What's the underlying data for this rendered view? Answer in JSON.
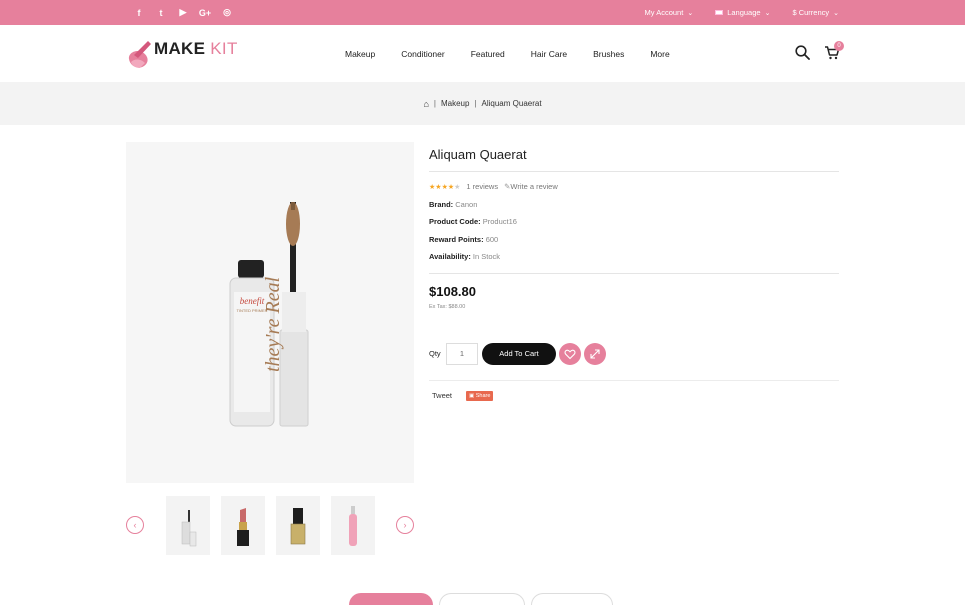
{
  "topbar": {
    "social_icons": [
      "facebook-icon",
      "twitter-icon",
      "youtube-icon",
      "google-plus-icon",
      "instagram-icon"
    ],
    "social_glyphs": [
      "f",
      "t",
      "▶",
      "G+",
      "◎"
    ],
    "account_label": "My Account",
    "language_label": "Language",
    "currency_label": "$ Currency"
  },
  "header": {
    "logo_part1": "MAKE",
    "logo_part2": "KIT",
    "nav": [
      "Makeup",
      "Conditioner",
      "Featured",
      "Hair Care",
      "Brushes",
      "More"
    ],
    "cart_count": "0"
  },
  "breadcrumb": {
    "home_icon": "home-icon",
    "items": [
      "Makeup",
      "Aliquam Quaerat"
    ]
  },
  "product": {
    "title": "Aliquam Quaerat",
    "rating": 4,
    "rating_max": 5,
    "reviews_label": "1 reviews",
    "write_review_label": "Write a review",
    "brand_label": "Brand:",
    "brand_value": "Canon",
    "code_label": "Product Code:",
    "code_value": "Product16",
    "points_label": "Reward Points:",
    "points_value": "600",
    "availability_label": "Availability:",
    "availability_value": "In Stock",
    "price": "$108.80",
    "ex_tax": "Ex Tax: $88.00",
    "qty_label": "Qty",
    "qty_value": "1",
    "add_to_cart_label": "Add To Cart",
    "tweet_label": "Tweet",
    "share_label": "Share"
  },
  "gallery": {
    "main_image": "mascara-tube",
    "thumbnails": [
      "mascara",
      "lipstick",
      "nail-polish",
      "pink-serum"
    ]
  },
  "colors": {
    "accent": "#e6809c",
    "topbar": "#e6809c",
    "button_dark": "#111111",
    "star": "#f6a623"
  }
}
